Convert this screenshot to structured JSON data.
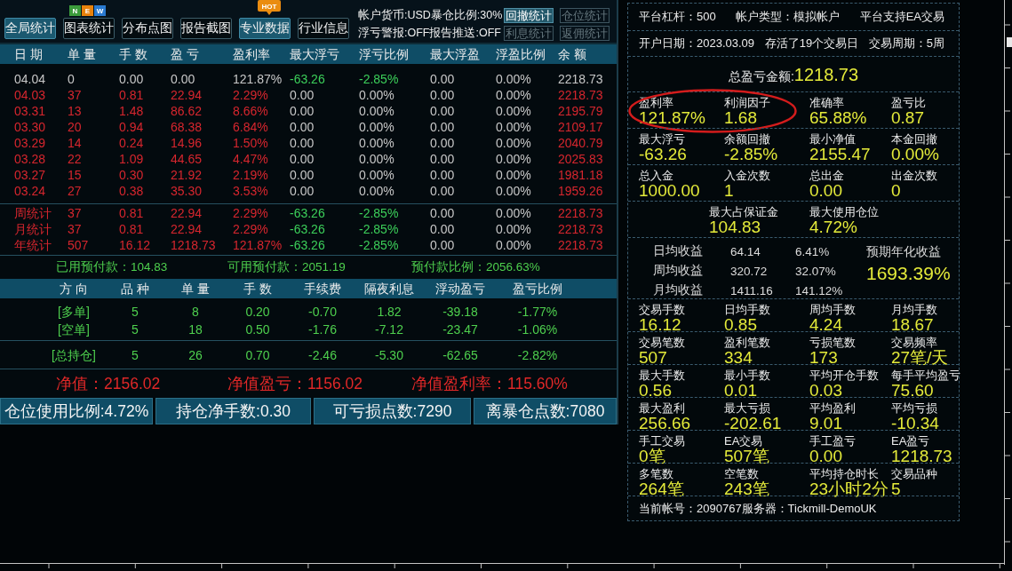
{
  "toolbar": {
    "buttons": [
      {
        "label": "全局统计",
        "selected": true
      },
      {
        "label": "图表统计",
        "selected": false,
        "badge": {
          "kind": "tiles",
          "tiles": [
            {
              "text": "N",
              "color": "#3c9c3c"
            },
            {
              "text": "E",
              "color": "#e8820c"
            },
            {
              "text": "W",
              "color": "#2a7ad0"
            }
          ]
        }
      },
      {
        "label": "分布点图",
        "selected": false
      },
      {
        "label": "报告截图",
        "selected": false
      },
      {
        "label": "专业数据",
        "selected": true,
        "badge": {
          "kind": "bubble",
          "text": "HOT"
        }
      },
      {
        "label": "行业信息",
        "selected": false
      }
    ],
    "account_info": [
      "帐户货币:USD暴仓比例:30%",
      "浮亏警报:OFF报告推送:OFF"
    ],
    "stat_buttons": [
      {
        "label": "回撤统计",
        "selected": true
      },
      {
        "label": "仓位统计",
        "selected": false
      },
      {
        "label": "利息统计",
        "selected": false
      },
      {
        "label": "返佣统计",
        "selected": false
      }
    ]
  },
  "daily_table": {
    "columns": [
      "日 期",
      "单 量",
      "手 数",
      "盈 亏",
      "盈利率",
      "最大浮亏",
      "浮亏比例",
      "最大浮盈",
      "浮盈比例",
      "余 额"
    ],
    "rows": [
      {
        "cells": [
          {
            "text": "04.04",
            "color": "#c8c8c8"
          },
          {
            "text": "0",
            "color": "#c8c8c8"
          },
          {
            "text": "0.00",
            "color": "#c8c8c8"
          },
          {
            "text": "0.00",
            "color": "#c8c8c8"
          },
          {
            "text": "121.87%",
            "color": "#c8c8c8"
          },
          {
            "text": "-63.26",
            "color": "#3ccf5a"
          },
          {
            "text": "-2.85%",
            "color": "#3ccf5a"
          },
          {
            "text": "0.00",
            "color": "#c8c8c8"
          },
          {
            "text": "0.00%",
            "color": "#c8c8c8"
          },
          {
            "text": "2218.73",
            "color": "#c8c8c8"
          }
        ]
      },
      {
        "cells": [
          {
            "text": "04.03",
            "color": "#d8262e"
          },
          {
            "text": "37",
            "color": "#d8262e"
          },
          {
            "text": "0.81",
            "color": "#d8262e"
          },
          {
            "text": "22.94",
            "color": "#d8262e"
          },
          {
            "text": "2.29%",
            "color": "#d8262e"
          },
          {
            "text": "0.00",
            "color": "#c8c8c8"
          },
          {
            "text": "0.00%",
            "color": "#c8c8c8"
          },
          {
            "text": "0.00",
            "color": "#c8c8c8"
          },
          {
            "text": "0.00%",
            "color": "#c8c8c8"
          },
          {
            "text": "2218.73",
            "color": "#d8262e"
          }
        ]
      },
      {
        "cells": [
          {
            "text": "03.31",
            "color": "#d8262e"
          },
          {
            "text": "13",
            "color": "#d8262e"
          },
          {
            "text": "1.48",
            "color": "#d8262e"
          },
          {
            "text": "86.62",
            "color": "#d8262e"
          },
          {
            "text": "8.66%",
            "color": "#d8262e"
          },
          {
            "text": "0.00",
            "color": "#c8c8c8"
          },
          {
            "text": "0.00%",
            "color": "#c8c8c8"
          },
          {
            "text": "0.00",
            "color": "#c8c8c8"
          },
          {
            "text": "0.00%",
            "color": "#c8c8c8"
          },
          {
            "text": "2195.79",
            "color": "#d8262e"
          }
        ]
      },
      {
        "cells": [
          {
            "text": "03.30",
            "color": "#d8262e"
          },
          {
            "text": "20",
            "color": "#d8262e"
          },
          {
            "text": "0.94",
            "color": "#d8262e"
          },
          {
            "text": "68.38",
            "color": "#d8262e"
          },
          {
            "text": "6.84%",
            "color": "#d8262e"
          },
          {
            "text": "0.00",
            "color": "#c8c8c8"
          },
          {
            "text": "0.00%",
            "color": "#c8c8c8"
          },
          {
            "text": "0.00",
            "color": "#c8c8c8"
          },
          {
            "text": "0.00%",
            "color": "#c8c8c8"
          },
          {
            "text": "2109.17",
            "color": "#d8262e"
          }
        ]
      },
      {
        "cells": [
          {
            "text": "03.29",
            "color": "#d8262e"
          },
          {
            "text": "14",
            "color": "#d8262e"
          },
          {
            "text": "0.24",
            "color": "#d8262e"
          },
          {
            "text": "14.96",
            "color": "#d8262e"
          },
          {
            "text": "1.50%",
            "color": "#d8262e"
          },
          {
            "text": "0.00",
            "color": "#c8c8c8"
          },
          {
            "text": "0.00%",
            "color": "#c8c8c8"
          },
          {
            "text": "0.00",
            "color": "#c8c8c8"
          },
          {
            "text": "0.00%",
            "color": "#c8c8c8"
          },
          {
            "text": "2040.79",
            "color": "#d8262e"
          }
        ]
      },
      {
        "cells": [
          {
            "text": "03.28",
            "color": "#d8262e"
          },
          {
            "text": "22",
            "color": "#d8262e"
          },
          {
            "text": "1.09",
            "color": "#d8262e"
          },
          {
            "text": "44.65",
            "color": "#d8262e"
          },
          {
            "text": "4.47%",
            "color": "#d8262e"
          },
          {
            "text": "0.00",
            "color": "#c8c8c8"
          },
          {
            "text": "0.00%",
            "color": "#c8c8c8"
          },
          {
            "text": "0.00",
            "color": "#c8c8c8"
          },
          {
            "text": "0.00%",
            "color": "#c8c8c8"
          },
          {
            "text": "2025.83",
            "color": "#d8262e"
          }
        ]
      },
      {
        "cells": [
          {
            "text": "03.27",
            "color": "#d8262e"
          },
          {
            "text": "15",
            "color": "#d8262e"
          },
          {
            "text": "0.30",
            "color": "#d8262e"
          },
          {
            "text": "21.92",
            "color": "#d8262e"
          },
          {
            "text": "2.19%",
            "color": "#d8262e"
          },
          {
            "text": "0.00",
            "color": "#c8c8c8"
          },
          {
            "text": "0.00%",
            "color": "#c8c8c8"
          },
          {
            "text": "0.00",
            "color": "#c8c8c8"
          },
          {
            "text": "0.00%",
            "color": "#c8c8c8"
          },
          {
            "text": "1981.18",
            "color": "#d8262e"
          }
        ]
      },
      {
        "cells": [
          {
            "text": "03.24",
            "color": "#d8262e"
          },
          {
            "text": "27",
            "color": "#d8262e"
          },
          {
            "text": "0.38",
            "color": "#d8262e"
          },
          {
            "text": "35.30",
            "color": "#d8262e"
          },
          {
            "text": "3.53%",
            "color": "#d8262e"
          },
          {
            "text": "0.00",
            "color": "#c8c8c8"
          },
          {
            "text": "0.00%",
            "color": "#c8c8c8"
          },
          {
            "text": "0.00",
            "color": "#c8c8c8"
          },
          {
            "text": "0.00%",
            "color": "#c8c8c8"
          },
          {
            "text": "1959.26",
            "color": "#d8262e"
          }
        ]
      }
    ],
    "summary_rows": [
      {
        "cells": [
          {
            "text": "周统计",
            "color": "#d8262e"
          },
          {
            "text": "37",
            "color": "#d8262e"
          },
          {
            "text": "0.81",
            "color": "#d8262e"
          },
          {
            "text": "22.94",
            "color": "#d8262e"
          },
          {
            "text": "2.29%",
            "color": "#d8262e"
          },
          {
            "text": "-63.26",
            "color": "#3ccf5a"
          },
          {
            "text": "-2.85%",
            "color": "#3ccf5a"
          },
          {
            "text": "0.00",
            "color": "#c8c8c8"
          },
          {
            "text": "0.00%",
            "color": "#c8c8c8"
          },
          {
            "text": "2218.73",
            "color": "#d8262e"
          }
        ]
      },
      {
        "cells": [
          {
            "text": "月统计",
            "color": "#d8262e"
          },
          {
            "text": "37",
            "color": "#d8262e"
          },
          {
            "text": "0.81",
            "color": "#d8262e"
          },
          {
            "text": "22.94",
            "color": "#d8262e"
          },
          {
            "text": "2.29%",
            "color": "#d8262e"
          },
          {
            "text": "-63.26",
            "color": "#3ccf5a"
          },
          {
            "text": "-2.85%",
            "color": "#3ccf5a"
          },
          {
            "text": "0.00",
            "color": "#c8c8c8"
          },
          {
            "text": "0.00%",
            "color": "#c8c8c8"
          },
          {
            "text": "2218.73",
            "color": "#d8262e"
          }
        ]
      },
      {
        "cells": [
          {
            "text": "年统计",
            "color": "#d8262e"
          },
          {
            "text": "507",
            "color": "#d8262e"
          },
          {
            "text": "16.12",
            "color": "#d8262e"
          },
          {
            "text": "1218.73",
            "color": "#d8262e"
          },
          {
            "text": "121.87%",
            "color": "#d8262e"
          },
          {
            "text": "-63.26",
            "color": "#3ccf5a"
          },
          {
            "text": "-2.85%",
            "color": "#3ccf5a"
          },
          {
            "text": "0.00",
            "color": "#c8c8c8"
          },
          {
            "text": "0.00%",
            "color": "#c8c8c8"
          },
          {
            "text": "2218.73",
            "color": "#d8262e"
          }
        ]
      }
    ]
  },
  "prepaid": [
    "已用预付款：104.83",
    "可用预付款：2051.19",
    "预付款比例：2056.63%"
  ],
  "positions_table": {
    "columns": [
      "方 向",
      "品 种",
      "单 量",
      "手 数",
      "手续费",
      "隔夜利息",
      "浮动盈亏",
      "盈亏比例"
    ],
    "rows": [
      {
        "cells": [
          "[多单]",
          "5",
          "8",
          "0.20",
          "-0.70",
          "1.82",
          "-39.18",
          "-1.77%"
        ]
      },
      {
        "cells": [
          "[空单]",
          "5",
          "18",
          "0.50",
          "-1.76",
          "-7.12",
          "-23.47",
          "-1.06%"
        ]
      }
    ],
    "total_row": {
      "cells": [
        "[总持仓]",
        "5",
        "26",
        "0.70",
        "-2.46",
        "-5.30",
        "-62.65",
        "-2.82%"
      ]
    }
  },
  "equity": [
    "净值：2156.02",
    "净值盈亏：1156.02",
    "净值盈利率：115.60%"
  ],
  "status_bar": [
    "仓位使用比例:4.72%",
    "持仓净手数:0.30",
    "可亏损点数:7290",
    "离暴仓点数:7080"
  ],
  "account_panel": {
    "info_rows": [
      [
        "平台杠杆：500",
        "帐户类型：模拟帐户",
        "平台支持EA交易"
      ],
      [
        "开户日期：2023.03.09",
        "存活了19个交易日",
        "交易周期：5周"
      ]
    ],
    "total_pnl": {
      "label": "总盈亏金额:",
      "value": "1218.73"
    },
    "stat_rows": [
      {
        "kind": "grid",
        "items": [
          {
            "label": "盈利率",
            "value": "121.87%",
            "circled": true
          },
          {
            "label": "利润因子",
            "value": "1.68",
            "circled": true
          },
          {
            "label": "准确率",
            "value": "65.88%",
            "circled": false
          },
          {
            "label": "盈亏比",
            "value": "0.87",
            "circled": false
          }
        ]
      },
      {
        "kind": "grid",
        "items": [
          {
            "label": "最大浮亏",
            "value": "-63.26",
            "circled": false
          },
          {
            "label": "余额回撤",
            "value": "-2.85%",
            "circled": false
          },
          {
            "label": "最小净值",
            "value": "2155.47",
            "circled": false
          },
          {
            "label": "本金回撤",
            "value": "0.00%",
            "circled": false
          }
        ]
      },
      {
        "kind": "grid",
        "items": [
          {
            "label": "总入金",
            "value": "1000.00",
            "circled": false
          },
          {
            "label": "入金次数",
            "value": "1",
            "circled": false
          },
          {
            "label": "总出金",
            "value": "0.00",
            "circled": false
          },
          {
            "label": "出金次数",
            "value": "0",
            "circled": false
          }
        ]
      },
      {
        "kind": "centered",
        "items": [
          {
            "label": "最大占保证金",
            "value": "104.83",
            "circled": false
          },
          {
            "label": "最大使用仓位",
            "value": "4.72%",
            "circled": false
          }
        ]
      }
    ],
    "averages": {
      "rows": [
        {
          "label": "日均收益",
          "amount": "64.14",
          "rate": "6.41%"
        },
        {
          "label": "周均收益",
          "amount": "320.72",
          "rate": "32.07%"
        },
        {
          "label": "月均收益",
          "amount": "1411.16",
          "rate": "141.12%"
        }
      ],
      "annual": {
        "label": "预期年化收益",
        "value": "1693.39%"
      }
    },
    "trade_rows": [
      [
        {
          "label": "交易手数",
          "value": "16.12"
        },
        {
          "label": "日均手数",
          "value": "0.85"
        },
        {
          "label": "周均手数",
          "value": "4.24"
        },
        {
          "label": "月均手数",
          "value": "18.67"
        }
      ],
      [
        {
          "label": "交易笔数",
          "value": "507"
        },
        {
          "label": "盈利笔数",
          "value": "334"
        },
        {
          "label": "亏损笔数",
          "value": "173"
        },
        {
          "label": "交易频率",
          "value": "27笔/天"
        }
      ],
      [
        {
          "label": "最大手数",
          "value": "0.56"
        },
        {
          "label": "最小手数",
          "value": "0.01"
        },
        {
          "label": "平均开仓手数",
          "value": "0.03"
        },
        {
          "label": "每手平均盈亏",
          "value": "75.60"
        }
      ],
      [
        {
          "label": "最大盈利",
          "value": "256.66"
        },
        {
          "label": "最大亏损",
          "value": "-202.61"
        },
        {
          "label": "平均盈利",
          "value": "9.01"
        },
        {
          "label": "平均亏损",
          "value": "-10.34"
        }
      ],
      [
        {
          "label": "手工交易",
          "value": "0笔"
        },
        {
          "label": "EA交易",
          "value": "507笔"
        },
        {
          "label": "手工盈亏",
          "value": "0.00"
        },
        {
          "label": "EA盈亏",
          "value": "1218.73"
        }
      ],
      [
        {
          "label": "多笔数",
          "value": "264笔"
        },
        {
          "label": "空笔数",
          "value": "243笔"
        },
        {
          "label": "平均持仓时长",
          "value": "23小时2分"
        },
        {
          "label": "交易品种",
          "value": "5"
        }
      ]
    ],
    "footer": "当前帐号：2090767服务器：Tickmill-DemoUK"
  }
}
